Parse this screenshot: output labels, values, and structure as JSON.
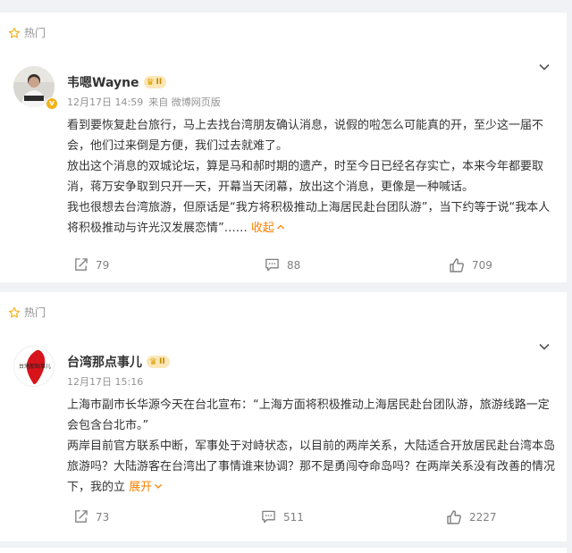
{
  "posts": [
    {
      "tag": "热门",
      "author": "韦嗯Wayne",
      "level": "II",
      "date": "12月17日 14:59",
      "source": "来自 微博网页版",
      "paragraphs": [
        "看到要恢复赴台旅行，马上去找台湾朋友确认消息，说假的啦怎么可能真的开，至少这一届不会，他们过来倒是方便，我们过去就难了。",
        "放出这个消息的双城论坛，算是马和郝时期的遗产，时至今日已经名存实亡，本来今年都要取消，蒋万安争取到只开一天，开幕当天闭幕，放出这个消息，更像是一种喊话。",
        "我也很想去台湾旅游，但原话是“我方将积极推动上海居民赴台团队游”，当下约等于说“我本人将积极推动与许光汉发展恋情”……"
      ],
      "toggle": "收起",
      "reposts": "79",
      "comments": "88",
      "likes": "709"
    },
    {
      "tag": "热门",
      "author": "台湾那点事儿",
      "level": "II",
      "date": "12月17日 15:16",
      "paragraphs": [
        "上海市副市长华源今天在台北宣布：“上海方面将积极推动上海居民赴台团队游，旅游线路一定会包含台北市。”",
        "两岸目前官方联系中断，军事处于对峙状态，以目前的两岸关系，大陆适合开放居民赴台湾本岛旅游吗？大陆游客在台湾出了事情谁来协调？那不是勇闯夺命岛吗？在两岸关系没有改善的情况下，我的立"
      ],
      "toggle": "展开",
      "avatar_text": "台灣那點事儿",
      "reposts": "73",
      "comments": "511",
      "likes": "2227"
    }
  ],
  "icons": {
    "hot": "star-icon",
    "more": "chevron-down-icon",
    "repost": "repost-icon",
    "comment": "comment-icon",
    "like": "thumbs-up-icon",
    "verified": "verified-badge-icon",
    "level": "crown-icon"
  },
  "colors": {
    "accent": "#ff8200",
    "meta": "#939393",
    "verified": "#f2b21a"
  }
}
